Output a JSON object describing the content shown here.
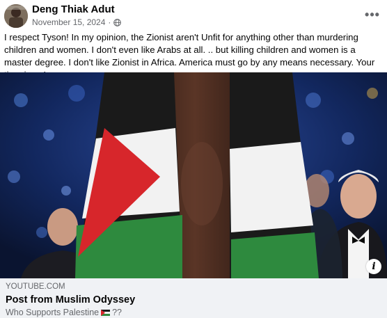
{
  "post": {
    "author": "Deng Thiak Adut",
    "date": "November 15, 2024",
    "date_separator": "·",
    "privacy_icon": "globe-icon",
    "more_label": "•••",
    "text": "I respect Tyson! In my opinion, the Zionist aren't Unfit for anything other than murdering children and women.  I don't even like Arabs at all. .. but killing children and women is a master degree. I don't like Zionist in Africa. America must go by any means necessary. Your time is up!"
  },
  "media": {
    "info_label": "i"
  },
  "link_card": {
    "domain": "YOUTUBE.COM",
    "title": "Post from Muslim Odyssey",
    "subtitle_prefix": "Who Supports Palestine ",
    "subtitle_suffix": "??"
  },
  "colors": {
    "flag_black": "#1a1a1a",
    "flag_white": "#f2f2f2",
    "flag_green": "#2e8a3e",
    "flag_red": "#d7262b",
    "card_bg": "#f0f2f5",
    "secondary_text": "#65676b"
  }
}
